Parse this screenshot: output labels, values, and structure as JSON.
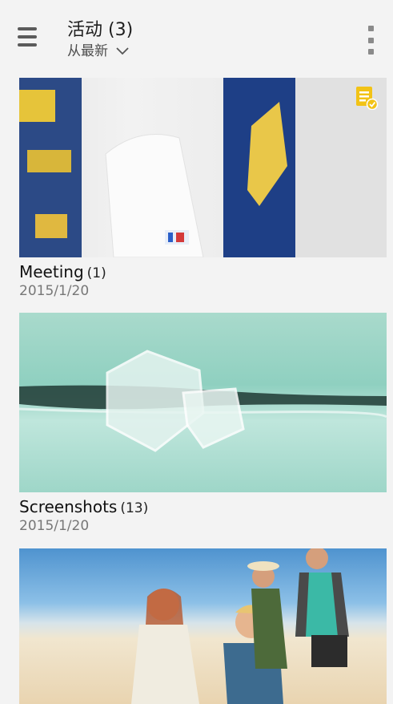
{
  "header": {
    "title": "活动 (3)",
    "sort_label": "从最新"
  },
  "albums": [
    {
      "name": "Meeting",
      "count": "(1)",
      "date": "2015/1/20",
      "badge_icon": "note-check-icon"
    },
    {
      "name": "Screenshots",
      "count": "(13)",
      "date": "2015/1/20"
    },
    {
      "name": "",
      "count": "",
      "date": ""
    }
  ],
  "colors": {
    "background": "#f3f3f3",
    "badge": "#f2c316"
  }
}
